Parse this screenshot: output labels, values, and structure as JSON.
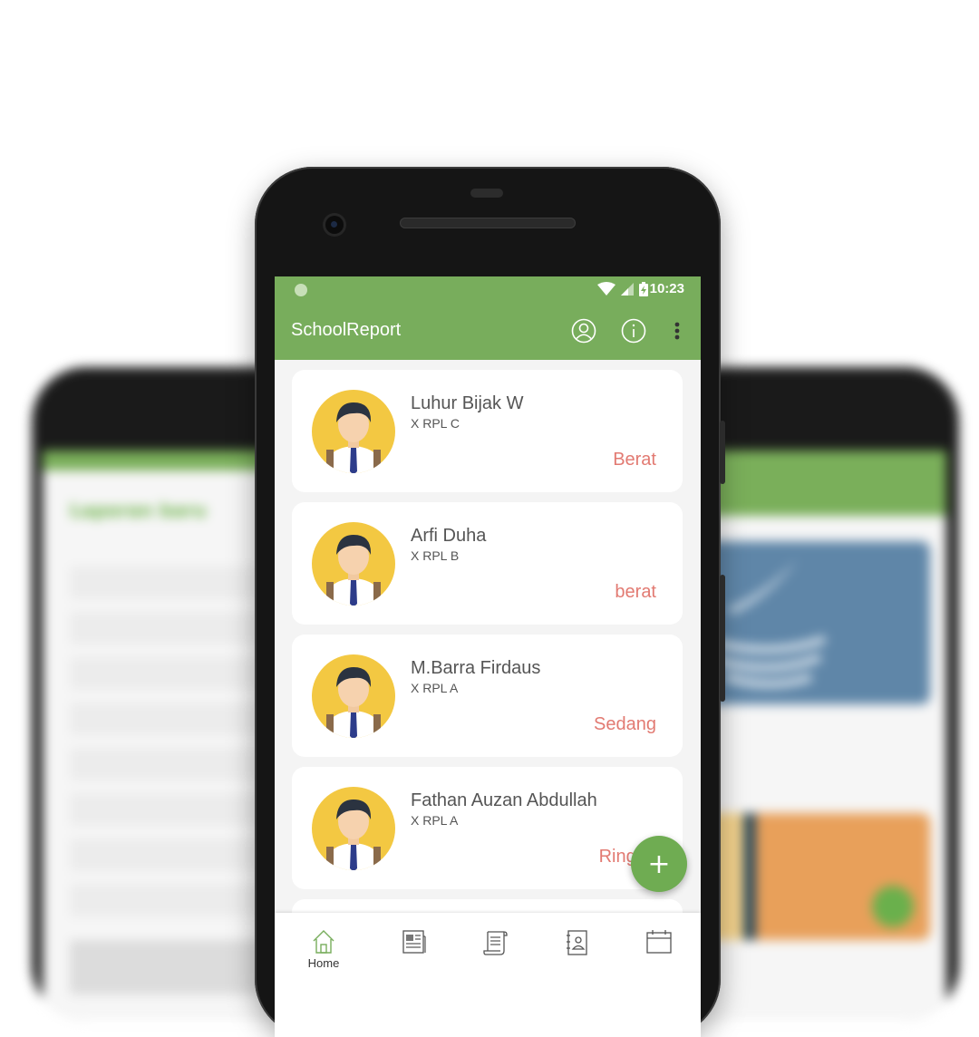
{
  "status_bar": {
    "time": "10:23",
    "icons": [
      "notification-dot-icon",
      "wifi-icon",
      "signal-icon",
      "battery-charging-icon"
    ]
  },
  "app_bar": {
    "title": "SchoolReport",
    "actions": [
      "user-icon",
      "info-icon",
      "more-vertical-icon"
    ]
  },
  "reports": [
    {
      "name": "Luhur Bijak W",
      "class": "X RPL C",
      "level": "Berat"
    },
    {
      "name": "Arfi Duha",
      "class": "X RPL B",
      "level": "berat"
    },
    {
      "name": "M.Barra Firdaus",
      "class": "X RPL A",
      "level": "Sedang"
    },
    {
      "name": "Fathan Auzan Abdullah",
      "class": "X RPL A",
      "level": "Ringan"
    }
  ],
  "fab": {
    "label": "+",
    "icon": "add-icon"
  },
  "bottom_nav": {
    "items": [
      {
        "label": "Home",
        "icon": "home-icon"
      },
      {
        "label": "",
        "icon": "newspaper-icon"
      },
      {
        "label": "",
        "icon": "scroll-icon"
      },
      {
        "label": "",
        "icon": "contacts-book-icon"
      },
      {
        "label": "",
        "icon": "calendar-icon"
      }
    ]
  },
  "background_screens": {
    "left_title": "Laporan baru",
    "right_fab": "+"
  },
  "colors": {
    "primary": "#78ad5c",
    "fab": "#6fac52",
    "level_text": "#e27a72",
    "screen_bg": "#f4f4f4"
  }
}
